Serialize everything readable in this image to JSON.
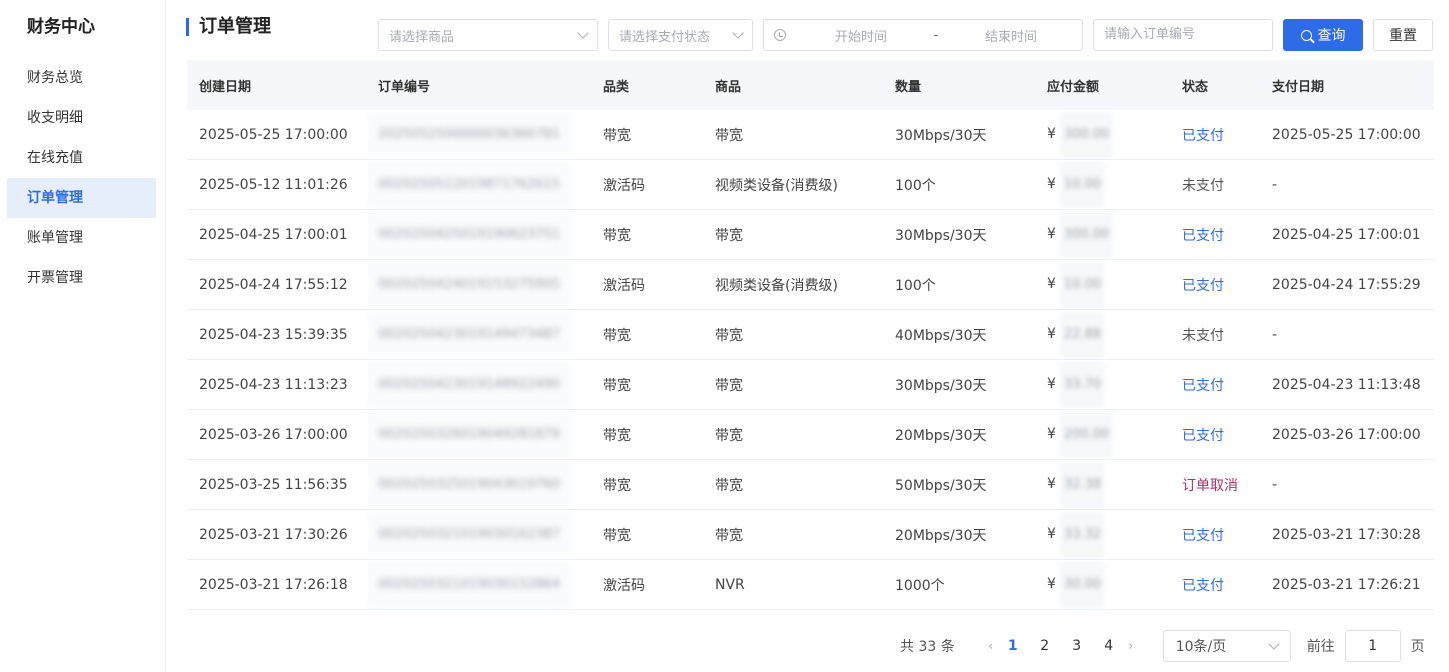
{
  "sidebar": {
    "title": "财务中心",
    "items": [
      {
        "label": "财务总览"
      },
      {
        "label": "收支明细"
      },
      {
        "label": "在线充值"
      },
      {
        "label": "订单管理"
      },
      {
        "label": "账单管理"
      },
      {
        "label": "开票管理"
      }
    ],
    "active_index": 3
  },
  "page": {
    "title": "订单管理"
  },
  "filters": {
    "product_placeholder": "请选择商品",
    "pay_status_placeholder": "请选择支付状态",
    "start_placeholder": "开始时间",
    "separator": "-",
    "end_placeholder": "结束时间",
    "order_no_placeholder": "请输入订单编号",
    "query_label": "查询",
    "reset_label": "重置"
  },
  "table": {
    "headers": [
      "创建日期",
      "订单编号",
      "品类",
      "商品",
      "数量",
      "应付金额",
      "状态",
      "支付日期"
    ],
    "currency": "¥",
    "rows": [
      {
        "created": "2025-05-25 17:00:00",
        "order_no": "2025052500000036366781",
        "category": "带宽",
        "product": "带宽",
        "qty": "30Mbps/30天",
        "amount": "300.00",
        "status": "已支付",
        "paid": "2025-05-25 17:00:00"
      },
      {
        "created": "2025-05-12 11:01:26",
        "order_no": "0020250512019871762615",
        "category": "激活码",
        "product": "视频类设备(消费级)",
        "qty": "100个",
        "amount": "10.00",
        "status": "未支付",
        "paid": "-"
      },
      {
        "created": "2025-04-25 17:00:01",
        "order_no": "0020250425019190623751",
        "category": "带宽",
        "product": "带宽",
        "qty": "30Mbps/30天",
        "amount": "300.00",
        "status": "已支付",
        "paid": "2025-04-25 17:00:01"
      },
      {
        "created": "2025-04-24 17:55:12",
        "order_no": "0020250424019153275905",
        "category": "激活码",
        "product": "视频类设备(消费级)",
        "qty": "100个",
        "amount": "10.00",
        "status": "已支付",
        "paid": "2025-04-24 17:55:29"
      },
      {
        "created": "2025-04-23 15:39:35",
        "order_no": "0020250423019149473487",
        "category": "带宽",
        "product": "带宽",
        "qty": "40Mbps/30天",
        "amount": "22.88",
        "status": "未支付",
        "paid": "-"
      },
      {
        "created": "2025-04-23 11:13:23",
        "order_no": "0020250423019148922490",
        "category": "带宽",
        "product": "带宽",
        "qty": "30Mbps/30天",
        "amount": "33.70",
        "status": "已支付",
        "paid": "2025-04-23 11:13:48"
      },
      {
        "created": "2025-03-26 17:00:00",
        "order_no": "0020250326019049281879",
        "category": "带宽",
        "product": "带宽",
        "qty": "20Mbps/30天",
        "amount": "200.00",
        "status": "已支付",
        "paid": "2025-03-26 17:00:00"
      },
      {
        "created": "2025-03-25 11:56:35",
        "order_no": "0020250325019043619760",
        "category": "带宽",
        "product": "带宽",
        "qty": "50Mbps/30天",
        "amount": "32.38",
        "status": "订单取消",
        "paid": "-"
      },
      {
        "created": "2025-03-21 17:30:26",
        "order_no": "0020250321019030162387",
        "category": "带宽",
        "product": "带宽",
        "qty": "20Mbps/30天",
        "amount": "33.32",
        "status": "已支付",
        "paid": "2025-03-21 17:30:28"
      },
      {
        "created": "2025-03-21 17:26:18",
        "order_no": "0020250321019030152864",
        "category": "激活码",
        "product": "NVR",
        "qty": "1000个",
        "amount": "30.00",
        "status": "已支付",
        "paid": "2025-03-21 17:26:21"
      }
    ]
  },
  "pagination": {
    "total_label": "共 33 条",
    "pages": [
      "1",
      "2",
      "3",
      "4"
    ],
    "current": "1",
    "page_size": "10条/页",
    "goto_label": "前往",
    "goto_value": "1",
    "page_suffix": "页"
  },
  "colors": {
    "accent": "#2e6be6",
    "cancel": "#b0306a"
  }
}
